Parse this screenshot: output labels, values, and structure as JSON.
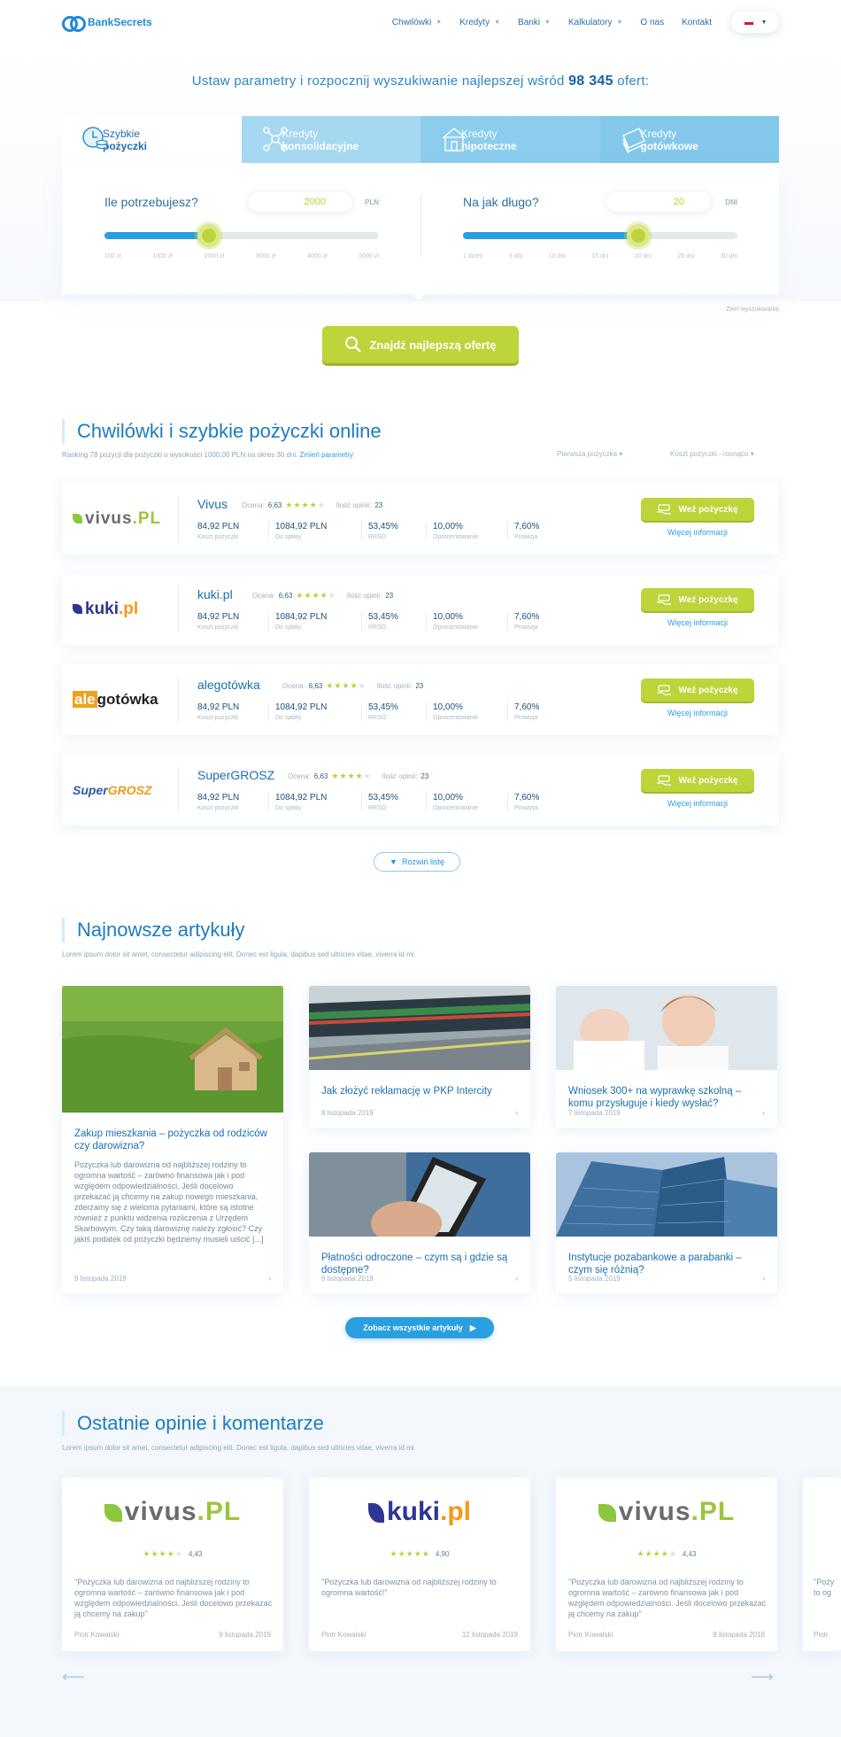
{
  "nav": {
    "brand": "BankSecrets",
    "items": [
      {
        "label": "Chwilówki",
        "caret": true
      },
      {
        "label": "Kredyty",
        "caret": true
      },
      {
        "label": "Banki",
        "caret": true
      },
      {
        "label": "Kalkulatory",
        "caret": true
      },
      {
        "label": "O nas",
        "caret": false
      },
      {
        "label": "Kontakt",
        "caret": false
      }
    ]
  },
  "hero": {
    "tagline_pre": "Ustaw parametry i rozpocznij wyszukiwanie najlepszej wśród",
    "tagline_num": "98 345",
    "tagline_post": "ofert:"
  },
  "tabs": [
    {
      "line1": "Szybkie",
      "line2": "pożyczki"
    },
    {
      "line1": "Kredyty",
      "line2": "konsolidacyjne"
    },
    {
      "line1": "Kredyty",
      "line2": "hipoteczne"
    },
    {
      "line1": "Kredyty",
      "line2": "gotówkowe"
    }
  ],
  "amount": {
    "question": "Ile potrzebujesz?",
    "value": "2000",
    "unit": "PLN",
    "level": 0.38,
    "ticks": [
      "100 zł",
      "1000 zł",
      "2000 zł",
      "3000 zł",
      "4000 zł",
      "5000 zł"
    ]
  },
  "duration": {
    "question": "Na jak długo?",
    "value": "20",
    "unit": "DNI",
    "level": 0.64,
    "ticks": [
      "1 dzień",
      "5 dni",
      "10 dni",
      "15 dni",
      "20 dni",
      "25 dni",
      "30 dni"
    ]
  },
  "collapse_label": "Zwiń wyszukiwarkę",
  "find_button": "Znajdź najlepszą ofertę",
  "ranking": {
    "title": "Chwilówki i szybkie pożyczki online",
    "subtitle": "Ranking 78 pozycji dla pożyczki o wysokości 1000,00 PLN na okres 30 dni.",
    "change_link": "Zmień parametry",
    "sort1": "Pierwsza pożyczka",
    "sort2": "Koszt pożyczki - rosnąco",
    "rating_label": "Ocena:",
    "opinions_label": "Ilość opinii:",
    "take_loan": "Weź pożyczkę",
    "more_info": "Więcej informacji",
    "col_labels": [
      "Koszt pożyczki",
      "Do spłaty",
      "RRSO",
      "Oprocentowanie",
      "Prowizja"
    ],
    "offers": [
      {
        "name": "Vivus",
        "rating": "6,63",
        "stars": 4,
        "opinions": "23",
        "values": [
          "84,92 PLN",
          "1084,92 PLN",
          "53,45%",
          "10,00%",
          "7,60%"
        ],
        "logo": "vivus"
      },
      {
        "name": "kuki.pl",
        "rating": "6,63",
        "stars": 4,
        "opinions": "23",
        "values": [
          "84,92 PLN",
          "1084,92 PLN",
          "53,45%",
          "10,00%",
          "7,60%"
        ],
        "logo": "kuki"
      },
      {
        "name": "alegotówka",
        "rating": "6,63",
        "stars": 4,
        "opinions": "23",
        "values": [
          "84,92 PLN",
          "1084,92 PLN",
          "53,45%",
          "10,00%",
          "7,60%"
        ],
        "logo": "alego"
      },
      {
        "name": "SuperGROSZ",
        "rating": "6,63",
        "stars": 4,
        "opinions": "23",
        "values": [
          "84,92 PLN",
          "1084,92 PLN",
          "53,45%",
          "10,00%",
          "7,60%"
        ],
        "logo": "super"
      }
    ],
    "expand": "Rozwiń listę"
  },
  "logos": {
    "vivus": [
      "vivus",
      ".PL"
    ],
    "kuki": [
      "kuki",
      ".pl"
    ],
    "alego": [
      "ale",
      "gotówka"
    ],
    "super": [
      "Super",
      "GROSZ"
    ]
  },
  "articles": {
    "title": "Najnowsze artykuły",
    "subtitle": "Lorem ipsum dolor sit amet, consectetur adipiscing elit. Donec est ligula, dapibus sed ultricies vitae, viverra id mi.",
    "items": [
      {
        "title": "Zakup mieszkania – pożyczka od rodziców czy darowizna?",
        "excerpt": "Pożyczka lub darowizna od najbliższej rodziny to ogromna wartość – zarówno finansowa jak i pod względem odpowiedzialności. Jeśli docelowo przekazać ją chcemy na zakup nowego mieszkania, zderzamy się z wieloma pytaniami, które są istotne również z punktu widzenia rozliczenia z Urzędem Skarbowym. Czy taką darowiznę należy zgłosić? Czy jakiś podatek od pożyczki będziemy musieli uiścić [...]",
        "date": "9 listopada 2019"
      },
      {
        "title": "Jak złożyć reklamację w PKP Intercity",
        "date": "8 listopada 2019"
      },
      {
        "title": "Wniosek 300+ na wyprawkę szkolną – komu przysługuje i kiedy wysłać?",
        "date": "7 listopada 2019"
      },
      {
        "title": "Płatności odroczone – czym są i gdzie są dostępne?",
        "date": "6 listopada 2019"
      },
      {
        "title": "Instytucje pozabankowe a parabanki – czym się różnią?",
        "date": "5 listopada 2019"
      }
    ],
    "all_button": "Zobacz wszystkie artykuły"
  },
  "opinions": {
    "title": "Ostatnie opinie i komentarze",
    "subtitle": "Lorem ipsum dolor sit amet, consectetur adipiscing elit. Donec est ligula, dapibus sed ultricies vitae, viverra id mi.",
    "items": [
      {
        "logo": "vivus",
        "stars": 4,
        "score": "4,43",
        "quote": "\"Pożyczka lub darowizna od najbliższej rodziny to ogromna wartość – zarówno finansowa jak i pod względem odpowiedzialności. Jeśli docelowo przekazać ją chcemy na zakup\"",
        "author": "Piotr Kowalski",
        "date": "9 listopada 2019"
      },
      {
        "logo": "kuki",
        "stars": 5,
        "score": "4,90",
        "quote": "\"Pożyczka lub darowizna od najbliższej rodziny to ogromna wartość!\"",
        "author": "Piotr Kowalski",
        "date": "12 listopada 2019"
      },
      {
        "logo": "vivus",
        "stars": 4,
        "score": "4,43",
        "quote": "\"Pożyczka lub darowizna od najbliższej rodziny to ogromna wartość – zarówno finansowa jak i pod względem odpowiedzialności. Jeśli docelowo przekazać ją chcemy na zakup\"",
        "author": "Piotr Kowalski",
        "date": "9 listopada 2019"
      },
      {
        "partial_quote": "\"Poży to og",
        "author": "Piotr"
      }
    ]
  },
  "colors": {
    "accent": "#2a9fe0",
    "cta": "#bdd43a",
    "heading": "#1d7cc0"
  }
}
